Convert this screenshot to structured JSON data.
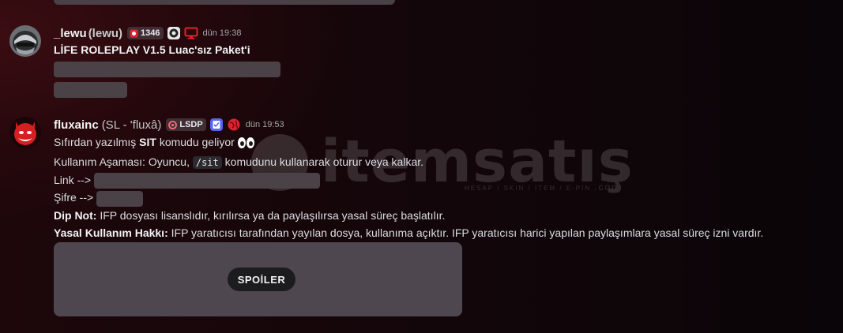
{
  "colors": {
    "accent_red": "#e0222f",
    "blurple": "#5865f2",
    "badge_bg": "#3f2f35"
  },
  "watermark": {
    "text": "itemsatış",
    "subtitle": "HESAP / SKIN / ITEM / E-PIN",
    "domain": ".com"
  },
  "messages": [
    {
      "username": "_lewu",
      "alt_name": "(lewu)",
      "tag": {
        "icon": "tag-icon",
        "text": "1346"
      },
      "badges": [
        "guild-badge-icon",
        "monitor-icon"
      ],
      "timestamp": "dün 19:38",
      "title": "LİFE ROLEPLAY V1.5 Luac'sız Paket'i"
    },
    {
      "username": "fluxainc",
      "pronouns": "(SL - 'fluxâ)",
      "tag": {
        "icon": "swirl-icon",
        "text": "LSDP"
      },
      "badges": [
        "notepad-icon",
        "globe-icon"
      ],
      "timestamp": "dün 19:53",
      "line1": {
        "before": "Sıfırdan yazılmış ",
        "bold": "SIT",
        "after": " komudu geliyor"
      },
      "line2": {
        "before": "Kullanım Aşaması: Oyuncu, ",
        "code": "/sit",
        "after": " komudunu kullanarak oturur veya kalkar."
      },
      "link_label": "Link -->",
      "password_label": "Şifre -->",
      "note": {
        "label": "Dip Not:",
        "text": " IFP dosyası lisanslıdır, kırılırsa ya da paylaşılırsa yasal süreç başlatılır."
      },
      "rights": {
        "label": "Yasal Kullanım Hakkı:",
        "text": " IFP yaratıcısı tarafından yayılan dosya, kullanıma açıktır. IFP yaratıcısı harici yapılan paylaşımlara yasal süreç izni vardır."
      },
      "spoiler_label": "SPOİLER"
    }
  ]
}
